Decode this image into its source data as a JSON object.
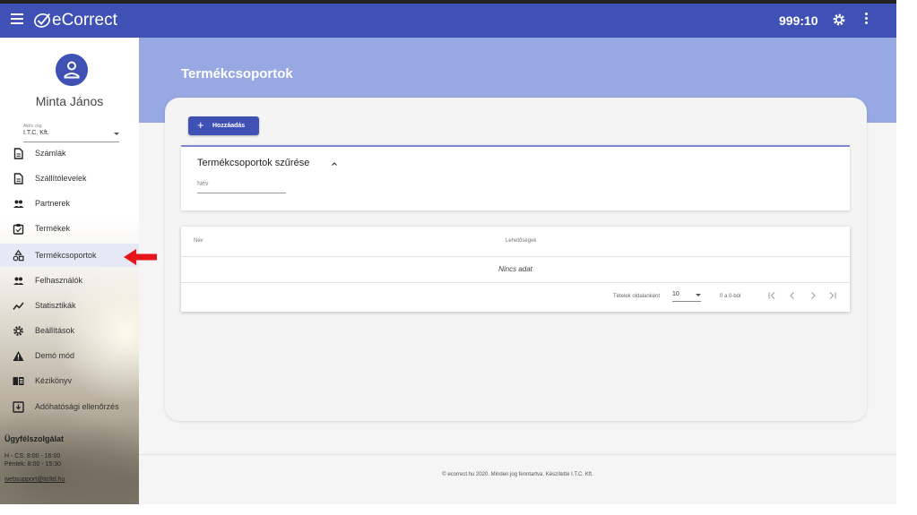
{
  "app": {
    "name": "eCorrect",
    "timer": "999:10"
  },
  "colors": {
    "primary": "#3f51b5",
    "banner": "#97a8e2",
    "arrow": "#e8141c"
  },
  "user": {
    "name": "Minta János",
    "company_label": "Aktív cég",
    "company": "I.T.C. Kft."
  },
  "sidebar": {
    "items": [
      {
        "label": "Számlák",
        "icon": "document-icon"
      },
      {
        "label": "Szállítólevelek",
        "icon": "document-icon"
      },
      {
        "label": "Partnerek",
        "icon": "people-icon"
      },
      {
        "label": "Termékek",
        "icon": "clipboard-icon"
      },
      {
        "label": "Termékcsoportok",
        "icon": "shapes-icon",
        "active": true
      },
      {
        "label": "Felhasználók",
        "icon": "people-icon"
      },
      {
        "label": "Statisztikák",
        "icon": "chart-line-icon"
      },
      {
        "label": "Beállítások",
        "icon": "gear-icon"
      },
      {
        "label": "Demó mód",
        "icon": "warning-icon"
      },
      {
        "label": "Kézikönyv",
        "icon": "book-icon"
      },
      {
        "label": "Adóhatósági ellenőrzés",
        "icon": "tax-box-icon"
      }
    ],
    "support": {
      "title": "Ügyfélszolgálat",
      "hours1": "H - CS: 8:00 - 16:00",
      "hours2": "Péntek: 8:00 - 15:30",
      "email": "websupport@itcltd.hu"
    }
  },
  "main": {
    "title": "Termékcsoportok",
    "add_button": "Hozzáadás",
    "filter": {
      "title": "Termékcsoportok szűrése",
      "name_placeholder": "Név"
    },
    "table": {
      "columns": [
        "Név",
        "Lehetőségek"
      ],
      "empty": "Nincs adat",
      "per_page_label": "Tételek oldalanként",
      "per_page_value": "10",
      "range": "0 a 0-ból"
    }
  },
  "footer": {
    "text": "© ecorrect.hu 2020. Minden jog fenntartva. Készítette I.T.C. Kft."
  }
}
